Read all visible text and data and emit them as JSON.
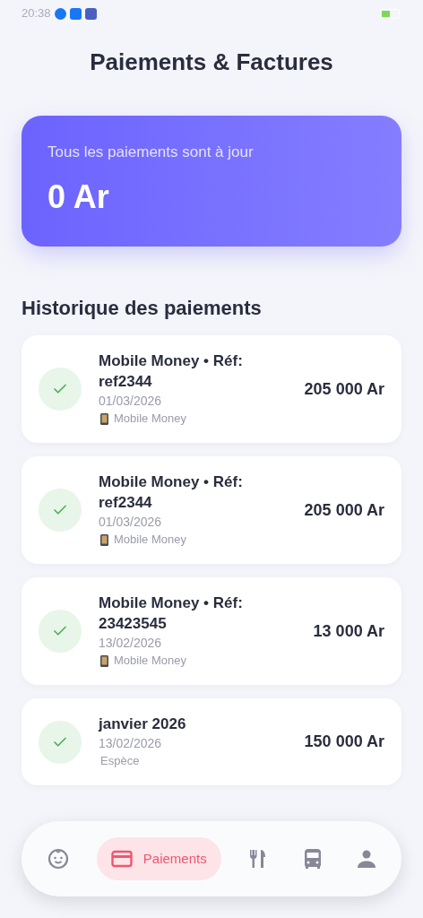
{
  "status_bar": {
    "time": "20:38"
  },
  "title": "Paiements & Factures",
  "summary": {
    "caption": "Tous les paiements sont à jour",
    "amount": "0 Ar"
  },
  "history": {
    "heading": "Historique des paiements",
    "payments": [
      {
        "title": "Mobile Money • Réf: ref2344",
        "date": "01/03/2026",
        "method": "Mobile Money",
        "kind": "mobile",
        "amount": "205 000 Ar",
        "paid": true
      },
      {
        "title": "Mobile Money • Réf: ref2344",
        "date": "01/03/2026",
        "method": "Mobile Money",
        "kind": "mobile",
        "amount": "205 000 Ar",
        "paid": true
      },
      {
        "title": "Mobile Money • Réf: 23423545",
        "date": "13/02/2026",
        "method": "Mobile Money",
        "kind": "mobile",
        "amount": "13 000 Ar",
        "paid": true
      },
      {
        "title": "janvier 2026",
        "date": "13/02/2026",
        "method": "Espèce",
        "kind": "cash",
        "amount": "150 000 Ar",
        "paid": true
      }
    ]
  },
  "nav": [
    {
      "selected": false
    },
    {
      "label": "Paiements",
      "selected": true
    },
    {
      "selected": false
    },
    {
      "selected": false
    },
    {
      "selected": false
    }
  ]
}
